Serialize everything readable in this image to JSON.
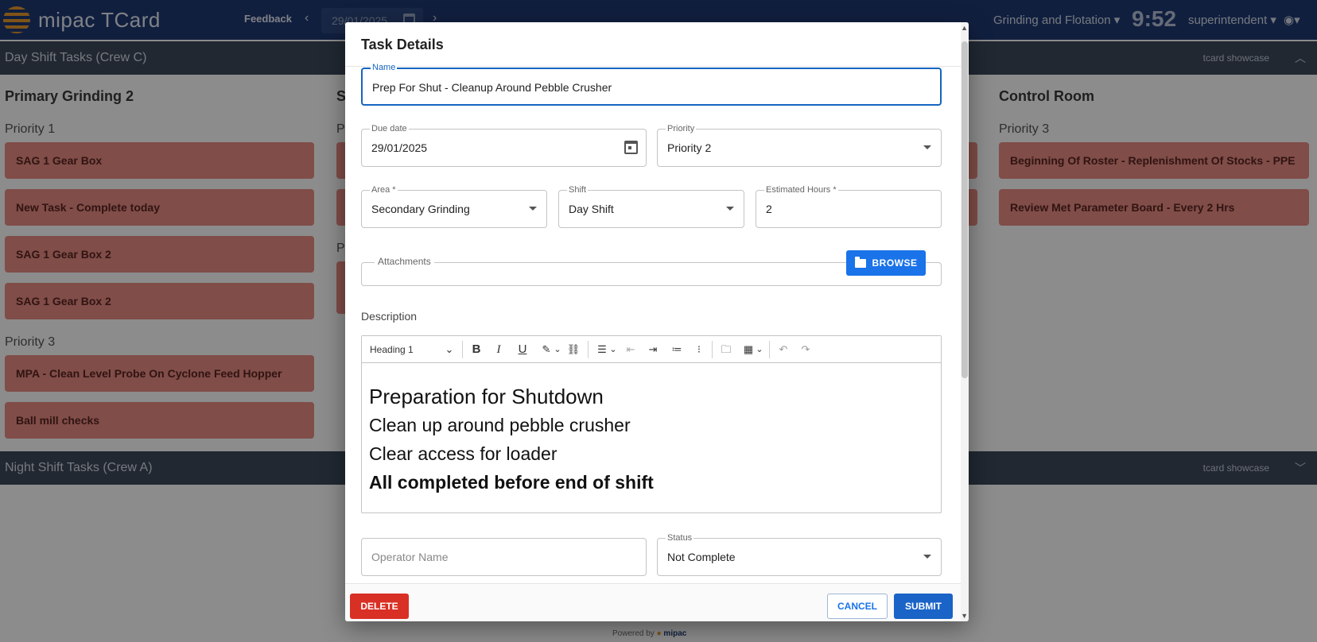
{
  "app": {
    "title": "mipac TCard",
    "feedback_label": "Feedback",
    "date_value": "29/01/2025",
    "site_selector": "Grinding and Flotation",
    "clock": "9:52",
    "user": "superintendent",
    "powered_by": "Powered by",
    "powered_brand": "mipac"
  },
  "day_shift": {
    "title": "Day Shift Tasks (Crew C)",
    "tag": "tcard showcase",
    "columns": [
      {
        "title": "Primary Grinding 2",
        "groups": [
          {
            "priority": "Priority 1",
            "tasks": [
              "SAG 1 Gear Box",
              "New Task - Complete today",
              "SAG 1 Gear Box 2",
              "SAG 1 Gear Box 2"
            ]
          },
          {
            "priority": "Priority 3",
            "tasks": [
              "MPA - Clean Level Probe On Cyclone Feed Hopper",
              "Ball mill checks"
            ]
          }
        ]
      },
      {
        "title": "S",
        "groups": [
          {
            "priority": "P",
            "tasks": []
          },
          {
            "priority": "P",
            "tasks": []
          }
        ]
      },
      {
        "title": "Control Room",
        "groups": [
          {
            "priority": "Priority 3",
            "tasks": [
              "Beginning Of Roster - Replenishment Of Stocks - PPE",
              "Review Met Parameter Board - Every 2 Hrs"
            ]
          }
        ]
      }
    ]
  },
  "night_shift": {
    "title": "Night Shift Tasks (Crew A)",
    "tag": "tcard showcase"
  },
  "modal": {
    "title": "Task Details",
    "name": {
      "label": "Name",
      "value": "Prep For Shut - Cleanup Around Pebble Crusher"
    },
    "due_date": {
      "label": "Due date",
      "value": "29/01/2025"
    },
    "priority": {
      "label": "Priority",
      "value": "Priority 2"
    },
    "area": {
      "label": "Area *",
      "value": "Secondary Grinding"
    },
    "shift": {
      "label": "Shift",
      "value": "Day Shift"
    },
    "estimated_hours": {
      "label": "Estimated Hours *",
      "value": "2"
    },
    "attachments_label": "Attachments",
    "browse_label": "BROWSE",
    "description_label": "Description",
    "editor": {
      "heading_select": "Heading 1",
      "lines": [
        "Preparation for Shutdown",
        "Clean up around pebble crusher",
        "Clear access for loader",
        "All completed before end of shift"
      ]
    },
    "operator": {
      "placeholder": "Operator Name"
    },
    "status": {
      "label": "Status",
      "value": "Not Complete"
    },
    "delete_label": "DELETE",
    "cancel_label": "CANCEL",
    "submit_label": "SUBMIT"
  },
  "colors": {
    "topbar": "#1f3a73",
    "shift_bar": "#3d4a5c",
    "task_card": "#e98c83",
    "primary": "#1a73e8",
    "danger": "#d93025"
  }
}
